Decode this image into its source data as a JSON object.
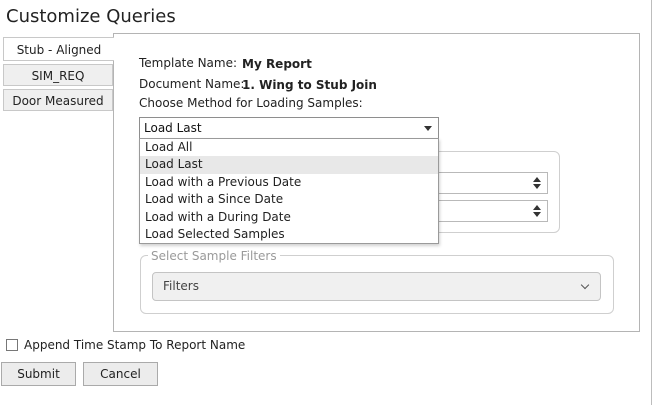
{
  "window": {
    "title": "Customize Queries"
  },
  "tabs": [
    {
      "label": "Stub - Aligned",
      "active": true
    },
    {
      "label": "SIM_REQ",
      "active": false
    },
    {
      "label": "Door Measured",
      "active": false
    }
  ],
  "form": {
    "template_name_label": "Template Name:",
    "template_name_value": "My Report",
    "document_name_label": "Document Name:",
    "document_name_value": "1. Wing to Stub Join",
    "method_label": "Choose Method for Loading Samples:",
    "method_selected": "Load Last"
  },
  "dropdown": {
    "options": [
      "Load All",
      "Load Last",
      "Load with a Previous Date",
      "Load with a Since Date",
      "Load with a During Date",
      "Load Selected Samples"
    ],
    "selected_index": 1
  },
  "filters": {
    "legend": "Select Sample Filters",
    "button_label": "Filters"
  },
  "append_timestamp": {
    "label": "Append Time Stamp To Report Name",
    "checked": false
  },
  "buttons": {
    "submit": "Submit",
    "cancel": "Cancel"
  },
  "colors": {
    "selected_option_bg": "#e8e8e8",
    "button_bg": "#ececec",
    "border": "#b4b4b4"
  }
}
